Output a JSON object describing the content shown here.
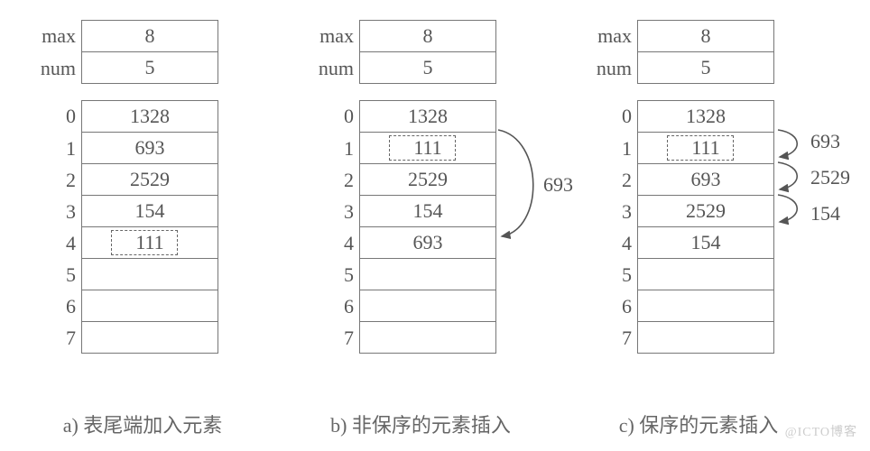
{
  "labels": {
    "max": "max",
    "num": "num"
  },
  "panels": {
    "a": {
      "max": "8",
      "num": "5",
      "cells": [
        "1328",
        "693",
        "2529",
        "154",
        "111",
        "",
        "",
        ""
      ],
      "highlight_index": 4,
      "caption": "a) 表尾端加入元素"
    },
    "b": {
      "max": "8",
      "num": "5",
      "cells": [
        "1328",
        "111",
        "2529",
        "154",
        "693",
        "",
        "",
        ""
      ],
      "highlight_index": 1,
      "caption": "b) 非保序的元素插入",
      "swap_label": "693"
    },
    "c": {
      "max": "8",
      "num": "5",
      "cells": [
        "1328",
        "111",
        "693",
        "2529",
        "154",
        "",
        "",
        ""
      ],
      "highlight_index": 1,
      "caption": "c) 保序的元素插入",
      "shift_labels": [
        "693",
        "2529",
        "154"
      ]
    }
  },
  "indices": [
    "0",
    "1",
    "2",
    "3",
    "4",
    "5",
    "6",
    "7"
  ],
  "watermark": "@ICTO博客"
}
